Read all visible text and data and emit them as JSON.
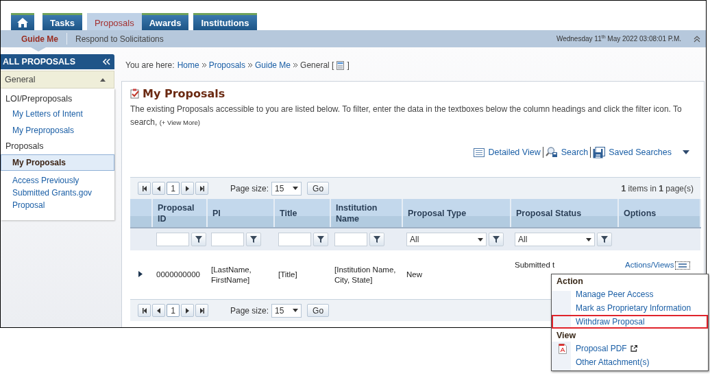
{
  "nav_tabs": [
    {
      "kind": "icon",
      "selected": false
    },
    {
      "kind": "text",
      "label": "Tasks",
      "selected": false
    },
    {
      "kind": "text",
      "label": "Proposals",
      "selected": true
    },
    {
      "kind": "text",
      "label": "Awards",
      "selected": false
    },
    {
      "kind": "text",
      "label": "Institutions",
      "selected": false
    }
  ],
  "subnav": {
    "items": [
      {
        "label": "Guide Me",
        "selected": true
      },
      {
        "label": "Respond to Solicitations",
        "selected": false
      }
    ],
    "datetime": "Wednesday 11$^{th}$ May 2022 03:08:01 P.M."
  },
  "sidebar": {
    "title": "ALL PROPOSALS",
    "section": {
      "label": "General",
      "expanded": true
    },
    "items": [
      {
        "kind": "heading",
        "label": "LOI/Preproposals",
        "selected": false
      },
      {
        "kind": "link",
        "label": "My Letters of Intent",
        "selected": false
      },
      {
        "kind": "link",
        "label": "My Preproposals",
        "selected": false
      },
      {
        "kind": "heading",
        "label": "Proposals",
        "selected": false
      },
      {
        "kind": "link",
        "label": "My Proposals",
        "selected": true
      },
      {
        "kind": "link",
        "label": "Access Previously Submitted Grants.gov Proposal",
        "selected": false
      }
    ]
  },
  "breadcrumb": {
    "label": "You are here:",
    "items": [
      "Home",
      "Proposals",
      "Guide Me"
    ],
    "current": "General [",
    "close": "]"
  },
  "panel": {
    "title": "My Proposals",
    "description": "The existing Proposals accessible to you are listed below. To filter, enter the data in the textboxes below the column headings and click the filter icon. To search,",
    "more": "(+ View More)"
  },
  "toolbar": [
    {
      "kind": "detailed",
      "label": "Detailed View"
    },
    {
      "kind": "search",
      "label": "Search"
    },
    {
      "kind": "saved",
      "label": "Saved Searches"
    }
  ],
  "pagers": [
    {
      "page": "1",
      "page_size_label": "Page size:",
      "page_size": "15",
      "go": "Go",
      "summary": "**1** items in **1** page(s)"
    },
    {
      "page": "1",
      "page_size_label": "Page size:",
      "page_size": "15",
      "go": "Go"
    }
  ],
  "table": {
    "columns": [
      "Proposal ID",
      "PI",
      "Title",
      "Institution Name",
      "Proposal Type",
      "Proposal Status",
      "Options"
    ],
    "filters": [
      {
        "kind": "text"
      },
      {
        "kind": "text"
      },
      {
        "kind": "text"
      },
      {
        "kind": "text"
      },
      {
        "kind": "select",
        "value": "All"
      },
      {
        "kind": "select",
        "value": "All"
      }
    ],
    "rows": [
      {
        "expanded": false,
        "cells": [
          "0000000000",
          "[LastName, FirstName]",
          "[Title]",
          "[Institution Name, City, State]",
          "New",
          "Submitted t",
          "Actions/Views"
        ]
      }
    ]
  },
  "menu": {
    "sections": [
      {
        "title": "Action",
        "items": [
          {
            "kind": "plain",
            "label": "Manage Peer Access",
            "highlighted": false
          },
          {
            "kind": "plain",
            "label": "Mark as Proprietary Information",
            "highlighted": false
          },
          {
            "kind": "plain",
            "label": "Withdraw Proposal",
            "highlighted": true
          }
        ]
      },
      {
        "title": "View",
        "items": [
          {
            "kind": "pdf",
            "label": "Proposal PDF",
            "highlighted": false
          },
          {
            "kind": "plain",
            "label": "Other Attachment(s)",
            "highlighted": false
          }
        ]
      }
    ]
  }
}
